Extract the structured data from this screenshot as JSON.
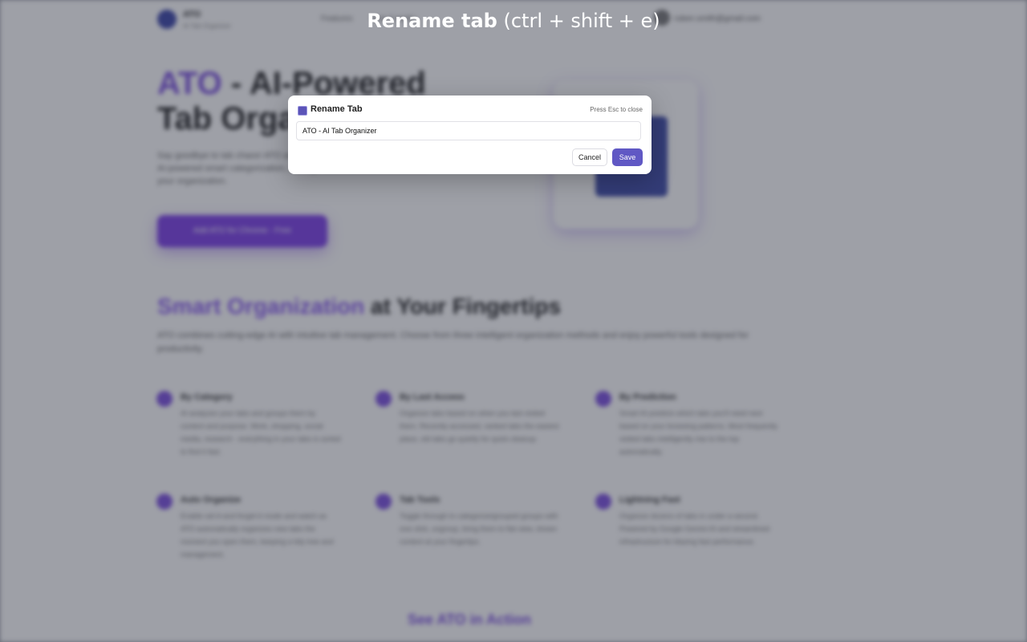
{
  "background_page": {
    "brand": "ATO",
    "brand_subtitle": "AI Tab Organizer",
    "nav_links": [
      "Features",
      "How it works"
    ],
    "user_email": "ruben.smith@gmail.com",
    "hero": {
      "title_accent": "ATO",
      "title_rest": " - AI-Powered Tab Organizer",
      "description": "Say goodbye to tab chaos! ATO automatically organizes your tabs with AI-powered smart categorization, manage bookmarks and streamline your organization.",
      "cta": "Add ATO for Chrome - Free"
    },
    "section": {
      "title_accent": "Smart Organization",
      "title_rest": " at Your Fingertips",
      "description": "ATO combines cutting-edge AI with intuitive tab management. Choose from three intelligent organization methods and enjoy powerful tools designed for productivity."
    },
    "features": [
      {
        "title": "By Category",
        "text": "AI analyzes your tabs and groups them by content and purpose. Work, shopping, social media, research - everything in your tabs is sorted to find it fast."
      },
      {
        "title": "By Last Access",
        "text": "Organize tabs based on when you last visited them. Recently accessed, ranked tabs the easiest place, old tabs go quietly for quick cleanup."
      },
      {
        "title": "By Prediction",
        "text": "Smart AI predicts which tabs you'll need next based on your browsing patterns. Most frequently visited tabs intelligently rise to the top automatically."
      },
      {
        "title": "Auto Organize",
        "text": "Enable set-it-and-forget-it mode and watch as ATO automatically organizes new tabs the moment you open them, keeping a tidy tree and management."
      },
      {
        "title": "Tab Tools",
        "text": "Toggle through to categorize/grouped groups with one click, ungroup, bring them to flat view, shown content at your fingertips."
      },
      {
        "title": "Lightning Fast",
        "text": "Organize dozens of tabs in under a second. Powered by Google Gemini AI and streamlined infrastructure for blazing fast performance."
      }
    ],
    "action_title": "See ATO in Action"
  },
  "shortcut_hint": {
    "strong": "Rename tab",
    "keys": "(ctrl + shift + e)"
  },
  "modal": {
    "title": "Rename Tab",
    "esc_hint": "Press Esc to close",
    "input_value": "ATO - AI Tab Organizer",
    "cancel_label": "Cancel",
    "save_label": "Save"
  },
  "colors": {
    "accent": "#6058c4",
    "brand_purple": "#7b4fe0"
  }
}
